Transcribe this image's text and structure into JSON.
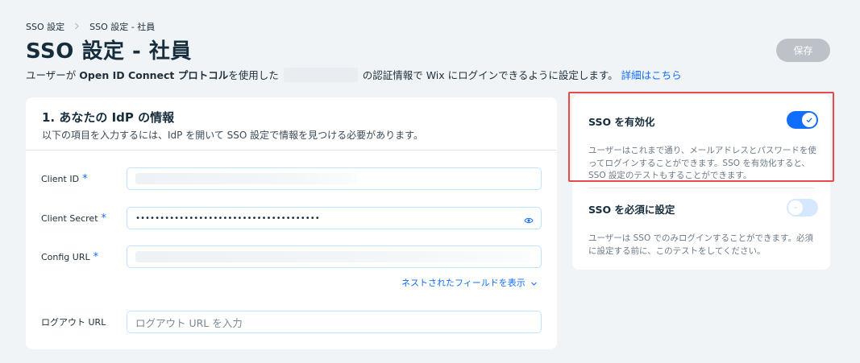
{
  "breadcrumb": {
    "items": [
      "SSO 設定",
      "SSO 設定 - 社員"
    ]
  },
  "page": {
    "title": "SSO 設定 - 社員",
    "subtitle_prefix": "ユーザーが",
    "subtitle_bold": "Open ID Connect プロトコル",
    "subtitle_mid": "を使用した",
    "subtitle_suffix": "の認証情報で Wix にログインできるように設定します。",
    "learn_more": "詳細はこちら",
    "save_label": "保存"
  },
  "idp_card": {
    "title": "1. あなたの IdP の情報",
    "description": "以下の項目を入力するには、IdP を開いて SSO 設定で情報を見つける必要があります。",
    "fields": [
      {
        "label": "Client ID",
        "required": "*",
        "value": ""
      },
      {
        "label": "Client Secret",
        "required": "*",
        "value": "••••••••••••••••••••••••••••••••••••••"
      },
      {
        "label": "Config URL",
        "required": "*",
        "value": ""
      },
      {
        "label": "ログアウト URL",
        "required": "",
        "placeholder": "ログアウト URL を入力"
      }
    ],
    "nested_fields_link": "ネストされたフィールドを表示"
  },
  "sso_card": {
    "enable": {
      "title": "SSO を有効化",
      "description": "ユーザーはこれまで通り、メールアドレスとパスワードを使ってログインすることができます。SSO を有効化すると、SSO 設定のテストもすることができます。",
      "state": "on"
    },
    "require": {
      "title": "SSO を必須に設定",
      "description": "ユーザーは SSO でのみログインすることができます。必須に設定する前に、このテストをしてください。",
      "state": "off"
    }
  },
  "colors": {
    "accent": "#116dff",
    "highlight": "#e84a4a",
    "save_disabled": "#bcc2c8"
  }
}
